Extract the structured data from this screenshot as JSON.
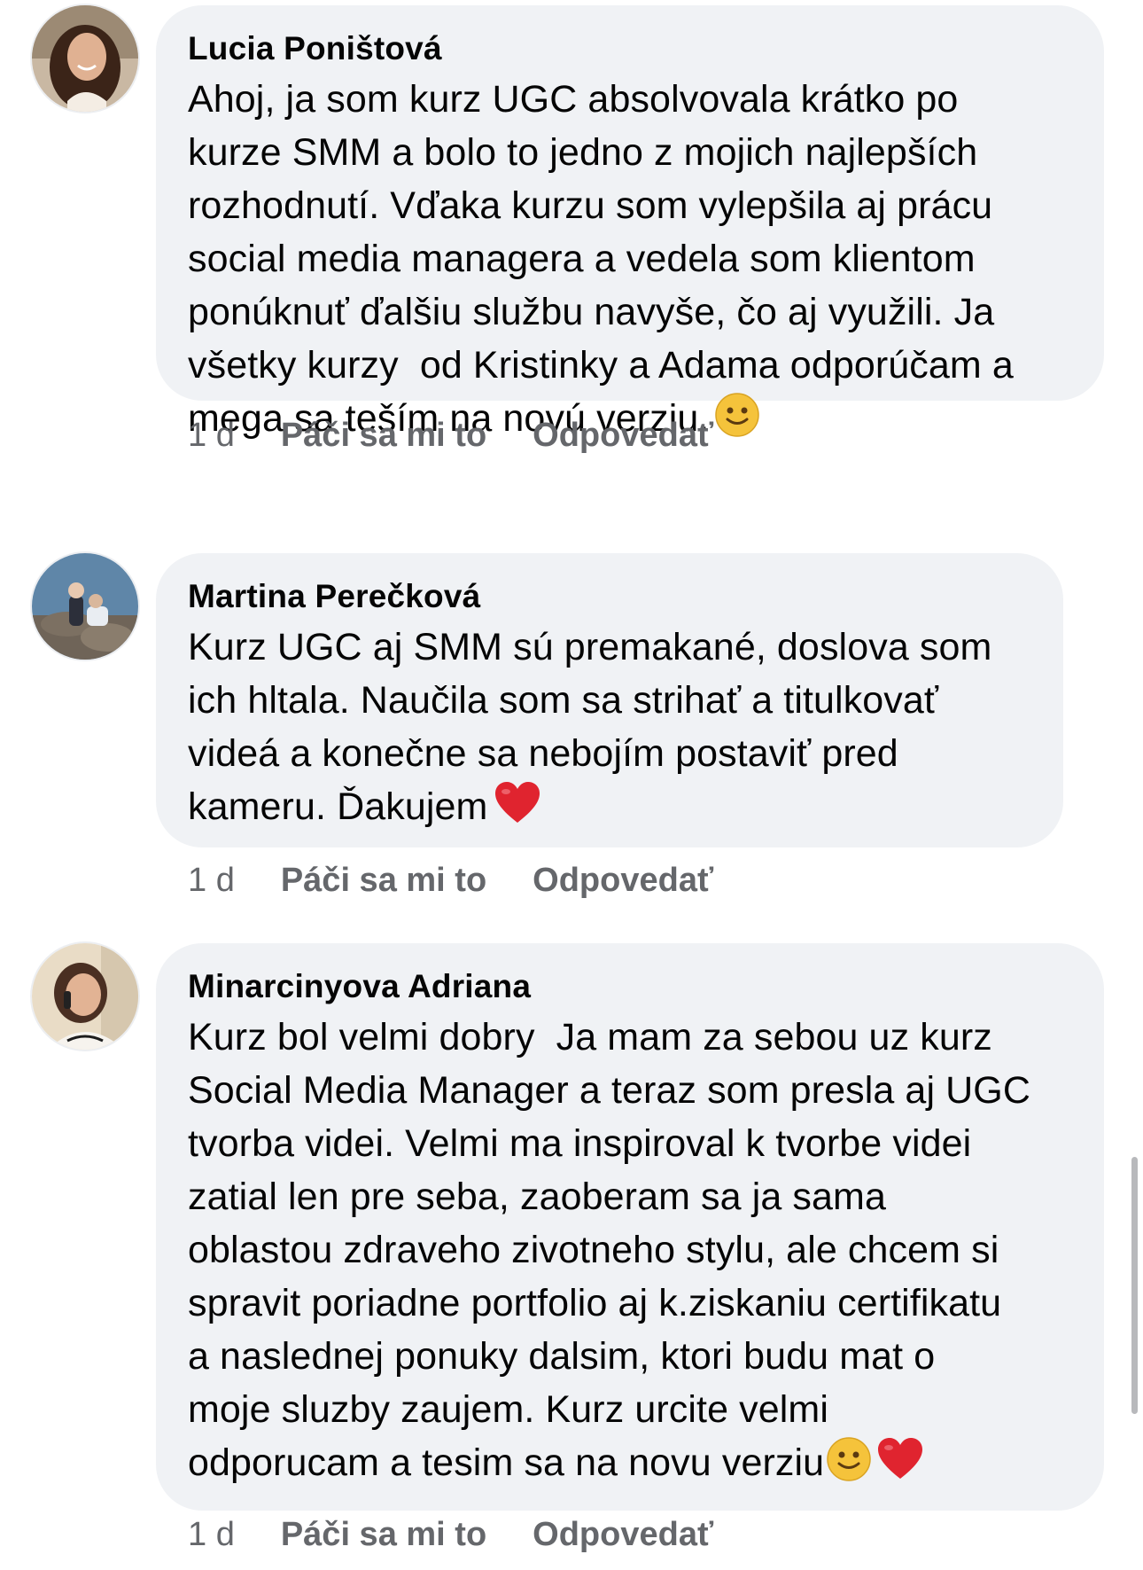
{
  "comments": [
    {
      "author": "Lucia Poništová",
      "text": "Ahoj, ja som kurz UGC absolvovala krátko po\nkurze SMM a bolo to jedno z mojich najlepších\nrozhodnutí. Vďaka kurzu som vylepšila aj prácu\nsocial media managera a vedela som klientom\nponúknuť ďalšiu službu navyše, čo aj využili. Ja\nvšetky kurzy  od Kristinky a Adama odporúčam a\nmega sa teším na novú verziu.",
      "emojis": [
        "slightly-smiling-face-emoji"
      ],
      "time": "1 d",
      "like_label": "Páči sa mi to",
      "reply_label": "Odpovedať"
    },
    {
      "author": "Martina Perečková",
      "text": "Kurz UGC aj SMM sú premakané, doslova som\nich hltala. Naučila som sa strihať a titulkovať\nvideá a konečne sa nebojím postaviť pred\nkameru. Ďakujem",
      "emojis": [
        "red-heart-emoji"
      ],
      "time": "1 d",
      "like_label": "Páči sa mi to",
      "reply_label": "Odpovedať"
    },
    {
      "author": "Minarcinyova Adriana",
      "text": "Kurz bol velmi dobry  Ja mam za sebou uz kurz\nSocial Media Manager a teraz som presla aj UGC\ntvorba videi. Velmi ma inspiroval k tvorbe videi\nzatial len pre seba, zaoberam sa ja sama\noblastou zdraveho zivotneho stylu, ale chcem si\nspravit poriadne portfolio aj k.ziskaniu certifikatu\na naslednej ponuky dalsim, ktori budu mat o\nmoje sluzby zaujem. Kurz urcite velmi\nodporucam a tesim sa na novu verziu",
      "emojis": [
        "slightly-smiling-face-emoji",
        "red-heart-emoji"
      ],
      "time": "1 d",
      "like_label": "Páči sa mi to",
      "reply_label": "Odpovedať"
    }
  ],
  "colors": {
    "bubble": "#f0f2f5",
    "meta_text": "#65676b",
    "name_text": "#050505",
    "heart": "#e0242f",
    "smile": "#f5c33b"
  }
}
